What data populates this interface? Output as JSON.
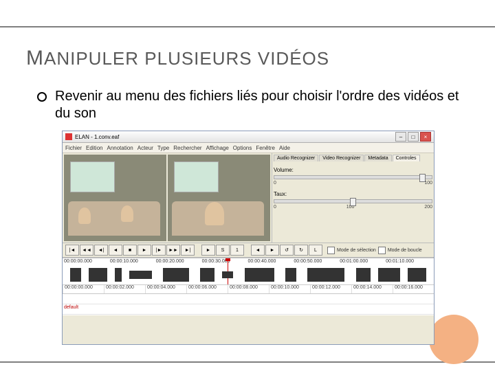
{
  "slide": {
    "title_pre": "M",
    "title_rest": "ANIPULER PLUSIEURS VIDÉOS",
    "bullet": "Revenir au menu des fichiers liés pour choisir l'ordre des vidéos et du son"
  },
  "app": {
    "title": "ELAN - 1.conv.eaf",
    "menu": [
      "Fichier",
      "Edition",
      "Annotation",
      "Acteur",
      "Type",
      "Rechercher",
      "Affichage",
      "Options",
      "Fenêtre",
      "Aide"
    ],
    "winbuttons": {
      "min": "–",
      "max": "□",
      "close": "×"
    },
    "tabs": [
      "Audio Recognizer",
      "Video Recognizer",
      "Metadata",
      "Controles"
    ],
    "controls": {
      "volume_label": "Volume:",
      "volume_scale": [
        "0",
        "100"
      ],
      "rate_label": "Taux:",
      "rate_scale": [
        "0",
        "100",
        "200"
      ]
    },
    "transport_buttons": [
      "|◄",
      "◄◄",
      "◄|",
      "◄",
      "■",
      "►",
      "|►",
      "►►",
      "►|",
      "►",
      "S",
      "1",
      "◄",
      "►",
      "↺",
      "↻",
      "L"
    ],
    "selection_label": "Mode de sélection",
    "loop_label": "Mode de boucle",
    "wave_times": [
      "00:00:00.000",
      "00:00:10.000",
      "00:00:20.000",
      "00:00:30.000",
      "00:00:40.000",
      "00:00:50.000",
      "00:01:00.000",
      "00:01:10.000"
    ],
    "ruler_times": [
      "00:00:00.000",
      "00:00:02.000",
      "00:00:04.000",
      "00:00:06.000",
      "00:00:08.000",
      "00:00:10.000",
      "00:00:12.000",
      "00:00:14.000",
      "00:00:16.000"
    ],
    "tier_label": "default"
  }
}
